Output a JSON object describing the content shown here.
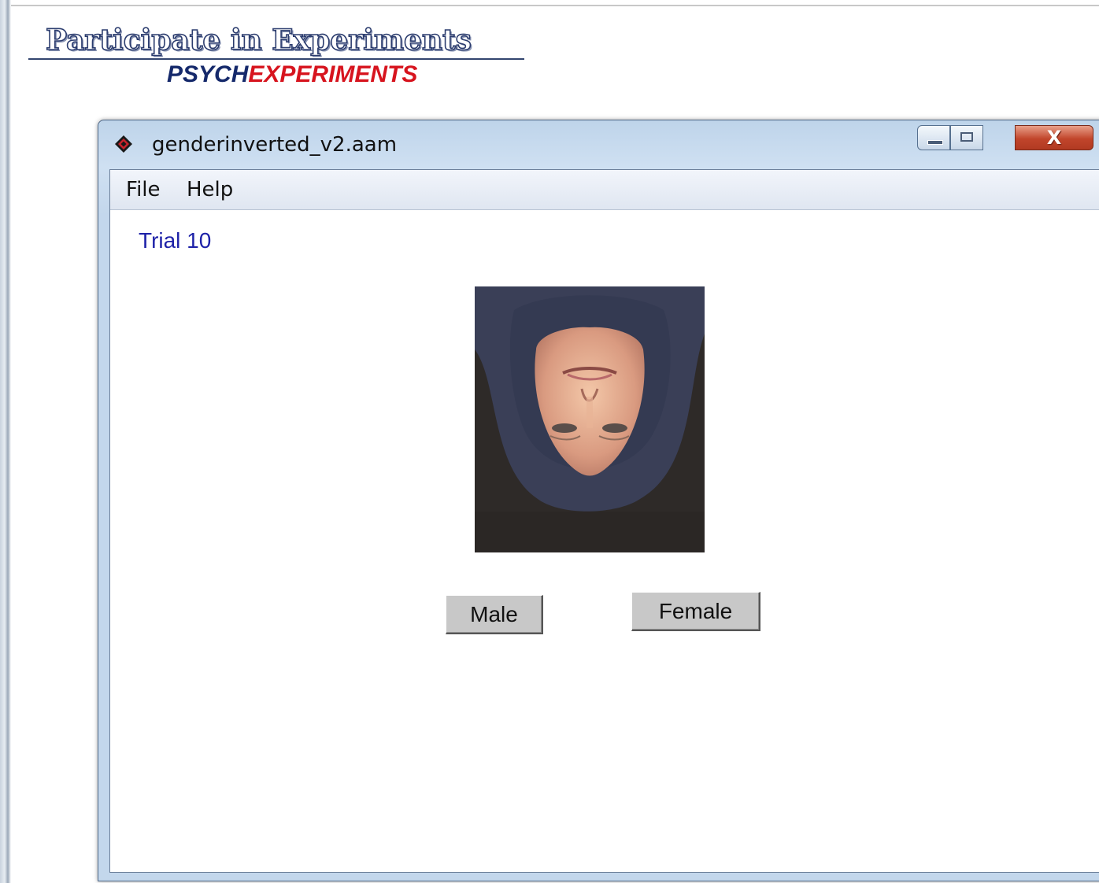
{
  "banner": {
    "title": "Participate in Experiments",
    "subtitle_part1": "PSYCH",
    "subtitle_part2": "EXPERIMENTS"
  },
  "window": {
    "title": "genderinverted_v2.aam",
    "icon": "diamond-app-icon",
    "controls": {
      "minimize_icon": "minimize-icon",
      "maximize_icon": "maximize-icon",
      "close_label": "X"
    },
    "menu": [
      {
        "label": "File"
      },
      {
        "label": "Help"
      }
    ]
  },
  "trial": {
    "label": "Trial 10"
  },
  "stimulus": {
    "description_icon": "inverted-face-photo"
  },
  "responses": {
    "male_label": "Male",
    "female_label": "Female"
  },
  "colors": {
    "trial_text": "#1e22a8",
    "brand_navy": "#15296b",
    "brand_red": "#d7141e",
    "close_button": "#c1452b"
  }
}
